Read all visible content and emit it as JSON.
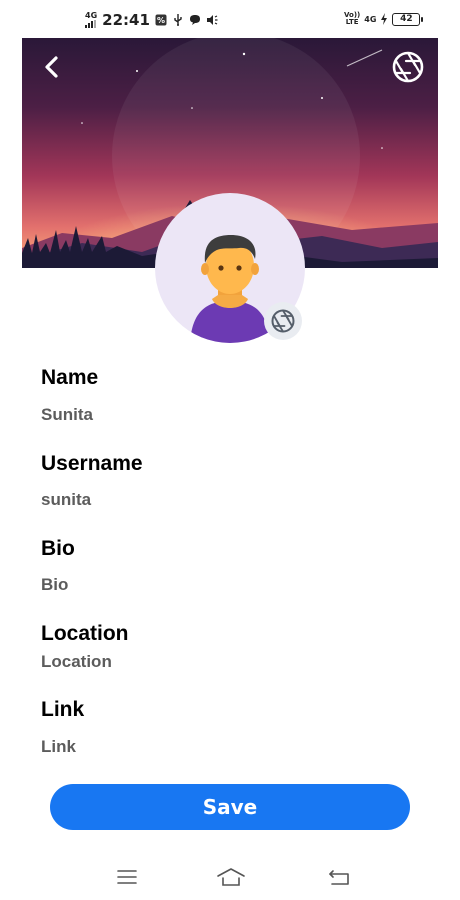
{
  "status_bar": {
    "network_left": "4G",
    "time": "22:41",
    "volte_line1": "Vo))",
    "volte_line2": "LTE",
    "network_right": "4G",
    "battery": "42"
  },
  "profile": {
    "fields": [
      {
        "label": "Name",
        "value": "Sunita",
        "placeholder": "Name"
      },
      {
        "label": "Username",
        "value": "sunita",
        "placeholder": "Username"
      },
      {
        "label": "Bio",
        "value": "",
        "placeholder": "Bio"
      },
      {
        "label": "Location",
        "value": "",
        "placeholder": "Location"
      },
      {
        "label": "Link",
        "value": "",
        "placeholder": "Link"
      }
    ],
    "save_label": "Save"
  },
  "colors": {
    "accent": "#1877f2",
    "label": "#000000",
    "value": "#5c5c5c",
    "avatar_bg": "#ece6f6"
  },
  "icons": {
    "back": "chevron-left-icon",
    "cover_camera": "aperture-icon",
    "avatar_camera": "aperture-icon",
    "nav_menu": "menu-icon",
    "nav_home": "home-icon",
    "nav_back": "back-arrow-icon"
  }
}
